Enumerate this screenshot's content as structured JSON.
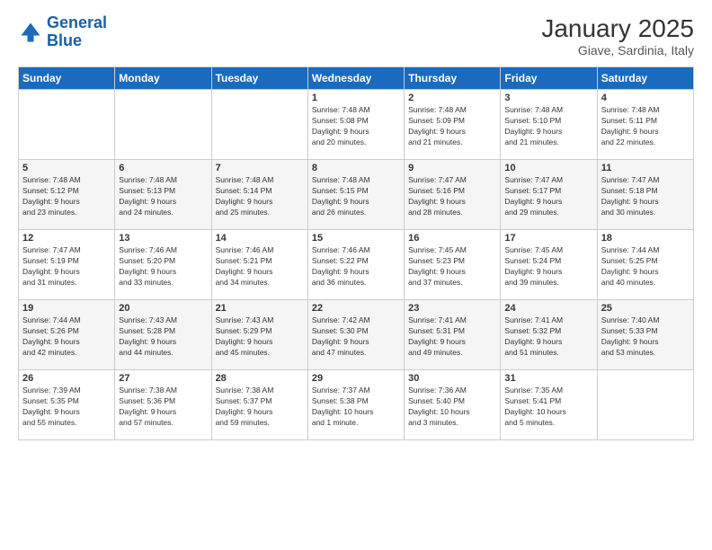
{
  "logo": {
    "line1": "General",
    "line2": "Blue"
  },
  "header": {
    "title": "January 2025",
    "subtitle": "Giave, Sardinia, Italy"
  },
  "weekdays": [
    "Sunday",
    "Monday",
    "Tuesday",
    "Wednesday",
    "Thursday",
    "Friday",
    "Saturday"
  ],
  "weeks": [
    [
      {
        "day": "",
        "info": ""
      },
      {
        "day": "",
        "info": ""
      },
      {
        "day": "",
        "info": ""
      },
      {
        "day": "1",
        "info": "Sunrise: 7:48 AM\nSunset: 5:08 PM\nDaylight: 9 hours\nand 20 minutes."
      },
      {
        "day": "2",
        "info": "Sunrise: 7:48 AM\nSunset: 5:09 PM\nDaylight: 9 hours\nand 21 minutes."
      },
      {
        "day": "3",
        "info": "Sunrise: 7:48 AM\nSunset: 5:10 PM\nDaylight: 9 hours\nand 21 minutes."
      },
      {
        "day": "4",
        "info": "Sunrise: 7:48 AM\nSunset: 5:11 PM\nDaylight: 9 hours\nand 22 minutes."
      }
    ],
    [
      {
        "day": "5",
        "info": "Sunrise: 7:48 AM\nSunset: 5:12 PM\nDaylight: 9 hours\nand 23 minutes."
      },
      {
        "day": "6",
        "info": "Sunrise: 7:48 AM\nSunset: 5:13 PM\nDaylight: 9 hours\nand 24 minutes."
      },
      {
        "day": "7",
        "info": "Sunrise: 7:48 AM\nSunset: 5:14 PM\nDaylight: 9 hours\nand 25 minutes."
      },
      {
        "day": "8",
        "info": "Sunrise: 7:48 AM\nSunset: 5:15 PM\nDaylight: 9 hours\nand 26 minutes."
      },
      {
        "day": "9",
        "info": "Sunrise: 7:47 AM\nSunset: 5:16 PM\nDaylight: 9 hours\nand 28 minutes."
      },
      {
        "day": "10",
        "info": "Sunrise: 7:47 AM\nSunset: 5:17 PM\nDaylight: 9 hours\nand 29 minutes."
      },
      {
        "day": "11",
        "info": "Sunrise: 7:47 AM\nSunset: 5:18 PM\nDaylight: 9 hours\nand 30 minutes."
      }
    ],
    [
      {
        "day": "12",
        "info": "Sunrise: 7:47 AM\nSunset: 5:19 PM\nDaylight: 9 hours\nand 31 minutes."
      },
      {
        "day": "13",
        "info": "Sunrise: 7:46 AM\nSunset: 5:20 PM\nDaylight: 9 hours\nand 33 minutes."
      },
      {
        "day": "14",
        "info": "Sunrise: 7:46 AM\nSunset: 5:21 PM\nDaylight: 9 hours\nand 34 minutes."
      },
      {
        "day": "15",
        "info": "Sunrise: 7:46 AM\nSunset: 5:22 PM\nDaylight: 9 hours\nand 36 minutes."
      },
      {
        "day": "16",
        "info": "Sunrise: 7:45 AM\nSunset: 5:23 PM\nDaylight: 9 hours\nand 37 minutes."
      },
      {
        "day": "17",
        "info": "Sunrise: 7:45 AM\nSunset: 5:24 PM\nDaylight: 9 hours\nand 39 minutes."
      },
      {
        "day": "18",
        "info": "Sunrise: 7:44 AM\nSunset: 5:25 PM\nDaylight: 9 hours\nand 40 minutes."
      }
    ],
    [
      {
        "day": "19",
        "info": "Sunrise: 7:44 AM\nSunset: 5:26 PM\nDaylight: 9 hours\nand 42 minutes."
      },
      {
        "day": "20",
        "info": "Sunrise: 7:43 AM\nSunset: 5:28 PM\nDaylight: 9 hours\nand 44 minutes."
      },
      {
        "day": "21",
        "info": "Sunrise: 7:43 AM\nSunset: 5:29 PM\nDaylight: 9 hours\nand 45 minutes."
      },
      {
        "day": "22",
        "info": "Sunrise: 7:42 AM\nSunset: 5:30 PM\nDaylight: 9 hours\nand 47 minutes."
      },
      {
        "day": "23",
        "info": "Sunrise: 7:41 AM\nSunset: 5:31 PM\nDaylight: 9 hours\nand 49 minutes."
      },
      {
        "day": "24",
        "info": "Sunrise: 7:41 AM\nSunset: 5:32 PM\nDaylight: 9 hours\nand 51 minutes."
      },
      {
        "day": "25",
        "info": "Sunrise: 7:40 AM\nSunset: 5:33 PM\nDaylight: 9 hours\nand 53 minutes."
      }
    ],
    [
      {
        "day": "26",
        "info": "Sunrise: 7:39 AM\nSunset: 5:35 PM\nDaylight: 9 hours\nand 55 minutes."
      },
      {
        "day": "27",
        "info": "Sunrise: 7:38 AM\nSunset: 5:36 PM\nDaylight: 9 hours\nand 57 minutes."
      },
      {
        "day": "28",
        "info": "Sunrise: 7:38 AM\nSunset: 5:37 PM\nDaylight: 9 hours\nand 59 minutes."
      },
      {
        "day": "29",
        "info": "Sunrise: 7:37 AM\nSunset: 5:38 PM\nDaylight: 10 hours\nand 1 minute."
      },
      {
        "day": "30",
        "info": "Sunrise: 7:36 AM\nSunset: 5:40 PM\nDaylight: 10 hours\nand 3 minutes."
      },
      {
        "day": "31",
        "info": "Sunrise: 7:35 AM\nSunset: 5:41 PM\nDaylight: 10 hours\nand 5 minutes."
      },
      {
        "day": "",
        "info": ""
      }
    ]
  ]
}
